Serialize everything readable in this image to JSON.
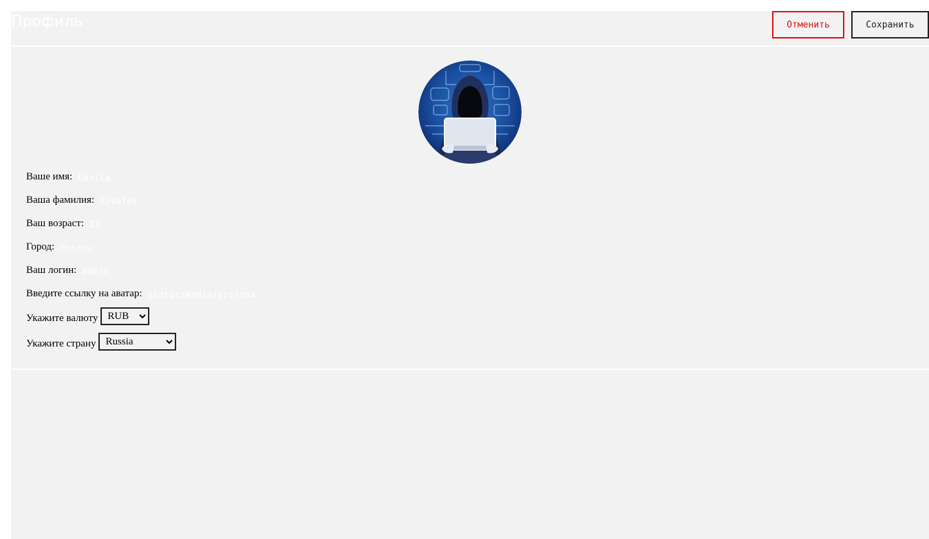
{
  "header": {
    "title": "Профиль",
    "cancel_label": "Отменить",
    "save_label": "Сохранить"
  },
  "avatar": {
    "icon": "hooded-hacker-avatar"
  },
  "form": {
    "first_name": {
      "label": "Ваше имя:",
      "value": "Danila"
    },
    "last_name": {
      "label": "Ваша фамилия:",
      "value": "Kovalev"
    },
    "age": {
      "label": "Ваш возраст:",
      "value": "22"
    },
    "city": {
      "label": "Город:",
      "value": "Moscow"
    },
    "login": {
      "label": "Ваш логин:",
      "value": "admin"
    },
    "avatar_url": {
      "label": "Введите ссылку на аватар:",
      "value": "static/media/src/sha"
    },
    "currency": {
      "label": "Укажите валюту",
      "selected": "RUB"
    },
    "country": {
      "label": "Укажите страну",
      "selected": "Russia"
    }
  },
  "colors": {
    "cancel": "#e01010",
    "save": "#222222",
    "background": "#f2f2f2",
    "avatar_bg": "#123a8a"
  }
}
